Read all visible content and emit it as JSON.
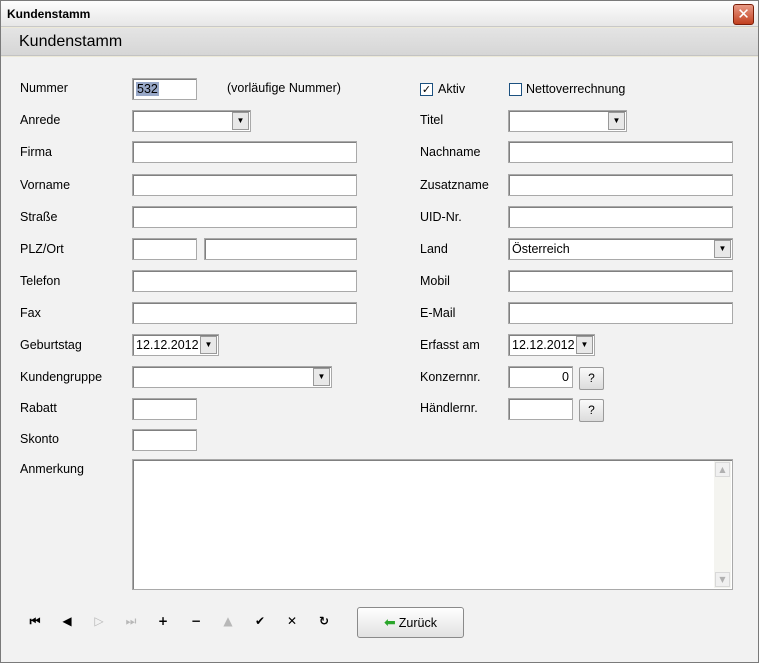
{
  "window": {
    "title": "Kundenstamm",
    "close_glyph": "✕"
  },
  "header": {
    "title": "Kundenstamm"
  },
  "form": {
    "nummer": {
      "label": "Nummer",
      "value": "532",
      "note": "(vorläufige Nummer)"
    },
    "aktiv": {
      "label": "Aktiv",
      "checked": true,
      "glyph": "✓"
    },
    "nettoverrechnung": {
      "label": "Nettoverrechnung",
      "checked": false
    },
    "anrede": {
      "label": "Anrede",
      "value": ""
    },
    "titel": {
      "label": "Titel",
      "value": ""
    },
    "firma": {
      "label": "Firma",
      "value": ""
    },
    "nachname": {
      "label": "Nachname",
      "value": ""
    },
    "vorname": {
      "label": "Vorname",
      "value": ""
    },
    "zusatzname": {
      "label": "Zusatzname",
      "value": ""
    },
    "strasse": {
      "label": "Straße",
      "value": ""
    },
    "uid": {
      "label": "UID-Nr.",
      "value": ""
    },
    "plzort": {
      "label": "PLZ/Ort",
      "plz": "",
      "ort": ""
    },
    "land": {
      "label": "Land",
      "value": "Österreich"
    },
    "telefon": {
      "label": "Telefon",
      "value": ""
    },
    "mobil": {
      "label": "Mobil",
      "value": ""
    },
    "fax": {
      "label": "Fax",
      "value": ""
    },
    "email": {
      "label": "E-Mail",
      "value": ""
    },
    "geburtstag": {
      "label": "Geburtstag",
      "value": "12.12.2012"
    },
    "erfasst": {
      "label": "Erfasst am",
      "value": "12.12.2012"
    },
    "kundengruppe": {
      "label": "Kundengruppe",
      "value": ""
    },
    "konzernnr": {
      "label": "Konzernnr.",
      "value": "0",
      "button": "?"
    },
    "rabatt": {
      "label": "Rabatt",
      "value": ""
    },
    "haendlernr": {
      "label": "Händlernr.",
      "value": "",
      "button": "?"
    },
    "skonto": {
      "label": "Skonto",
      "value": ""
    },
    "anmerkung": {
      "label": "Anmerkung",
      "value": ""
    }
  },
  "dropdown_glyph": "▼",
  "scroll_glyphs": {
    "up": "▲",
    "down": "▼"
  },
  "navigator": {
    "first": "⏮",
    "prior": "◀",
    "next": "▷",
    "last": "⏭",
    "insert": "+",
    "delete": "−",
    "edit": "▲",
    "post": "✔",
    "cancel": "✕",
    "refresh": "↻"
  },
  "back_button": {
    "arrow": "⬅",
    "label": "Zurück"
  }
}
